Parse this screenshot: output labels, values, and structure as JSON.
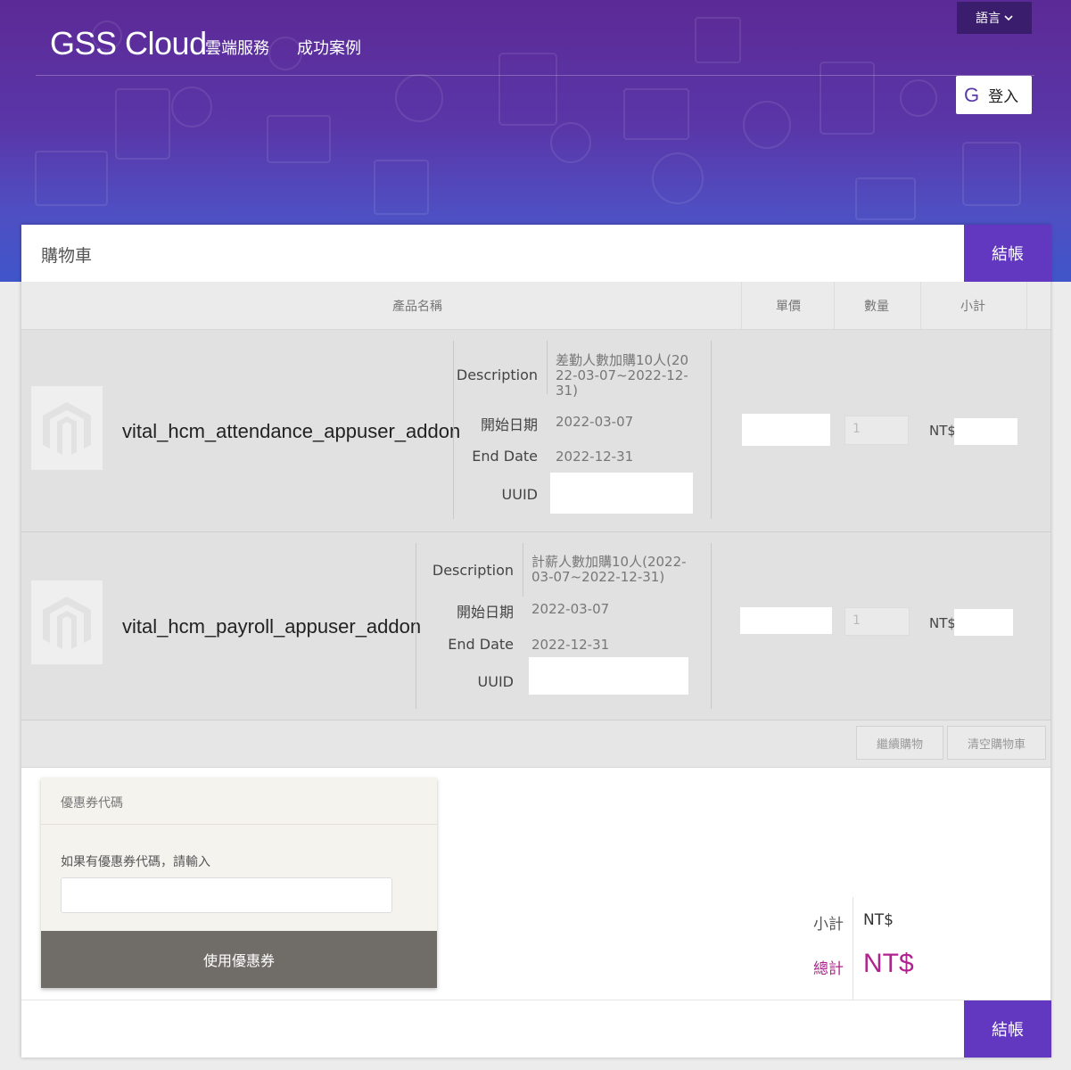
{
  "header": {
    "brand": "GSS Cloud",
    "nav": [
      "雲端服務",
      "成功案例"
    ],
    "language_label": "語言",
    "login_icon": "G",
    "login_label": "登入"
  },
  "cart": {
    "title": "購物車",
    "checkout_label": "結帳",
    "columns": [
      "產品名稱",
      "單價",
      "數量",
      "小計"
    ],
    "detail_labels": {
      "description": "Description",
      "start_date": "開始日期",
      "end_date": "End Date",
      "uuid": "UUID"
    },
    "items": [
      {
        "name": "vital_hcm_attendance_appuser_addon",
        "description_lines": [
          "差勤人數加購10人(20",
          "22-03-07~2022-12-",
          "31)"
        ],
        "start_date": "2022-03-07",
        "end_date": "2022-12-31",
        "quantity": "1",
        "currency": "NT$"
      },
      {
        "name": "vital_hcm_payroll_appuser_addon",
        "description_lines": [
          "計薪人數加購10人(2022-",
          "03-07~2022-12-31)"
        ],
        "start_date": "2022-03-07",
        "end_date": "2022-12-31",
        "quantity": "1",
        "currency": "NT$"
      }
    ],
    "continue_label": "繼續購物",
    "clear_label": "清空購物車"
  },
  "coupon": {
    "title": "優惠券代碼",
    "hint": "如果有優惠券代碼，請輸入",
    "input_value": "",
    "apply_label": "使用優惠券"
  },
  "totals": {
    "subtotal_label": "小計",
    "subtotal_value": "NT$",
    "total_label": "總計",
    "total_value": "NT$"
  },
  "colors": {
    "accent": "#6338c0",
    "total": "#b0228e",
    "hero_top": "#5c2a96",
    "hero_bottom": "#3f55c9"
  }
}
